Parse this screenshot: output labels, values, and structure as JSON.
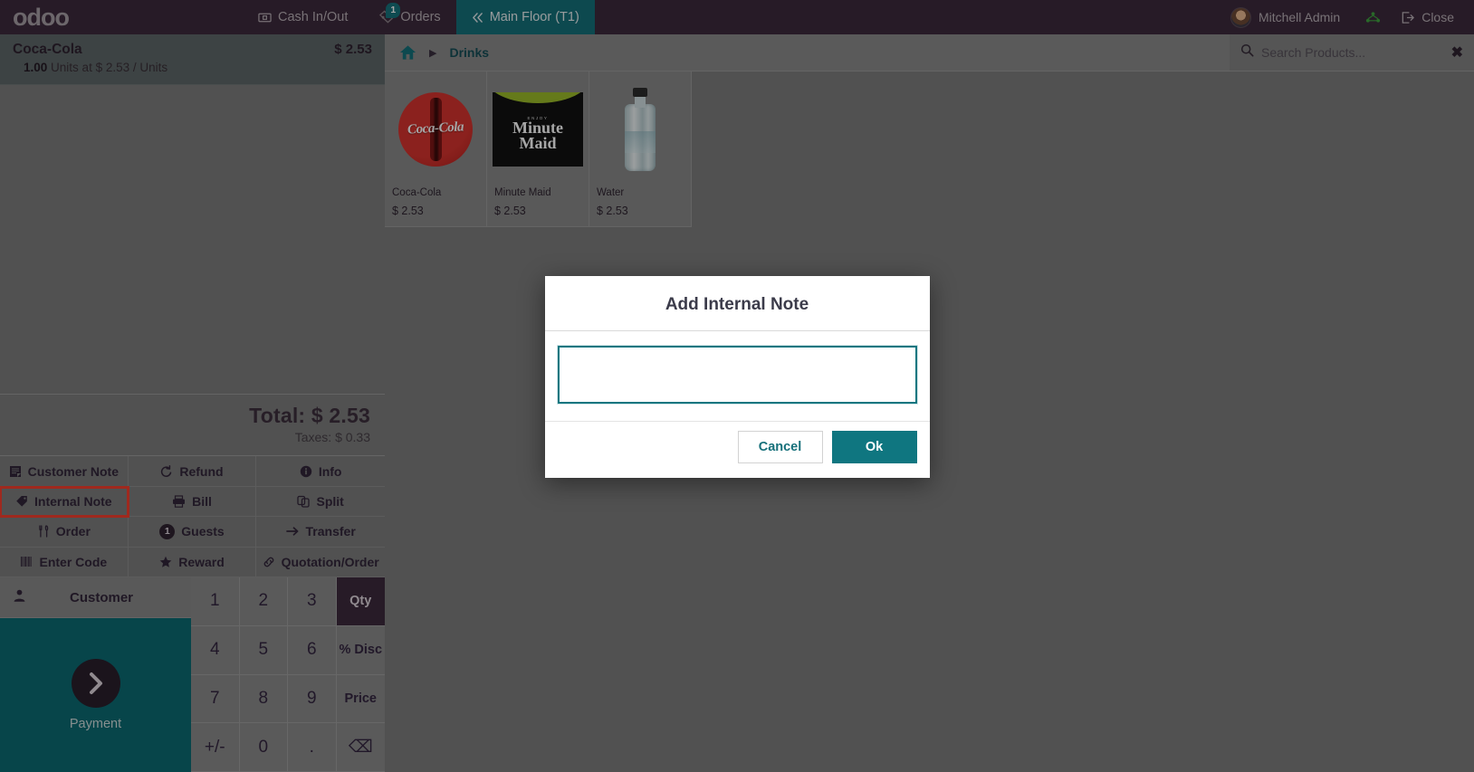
{
  "topbar": {
    "logo": "odoo",
    "cash_in_out": "Cash In/Out",
    "orders": "Orders",
    "orders_badge": "1",
    "floor": "Main Floor (T1)",
    "user": "Mitchell Admin",
    "close": "Close"
  },
  "order": {
    "lines": [
      {
        "name": "Coca-Cola",
        "price": "$ 2.53",
        "qty": "1.00",
        "detail": "Units at $ 2.53 / Units"
      }
    ],
    "total_label": "Total: $ 2.53",
    "taxes_label": "Taxes: $ 0.33"
  },
  "actions": [
    {
      "label": "Customer Note",
      "icon": "note-icon"
    },
    {
      "label": "Refund",
      "icon": "refund-icon"
    },
    {
      "label": "Info",
      "icon": "info-icon"
    },
    {
      "label": "Internal Note",
      "icon": "tag-icon",
      "highlight": true
    },
    {
      "label": "Bill",
      "icon": "printer-icon"
    },
    {
      "label": "Split",
      "icon": "split-icon"
    },
    {
      "label": "Order",
      "icon": "cutlery-icon"
    },
    {
      "label": "Guests",
      "icon": "guests-icon",
      "badge": "1"
    },
    {
      "label": "Transfer",
      "icon": "arrow-right-icon"
    },
    {
      "label": "Enter Code",
      "icon": "barcode-icon"
    },
    {
      "label": "Reward",
      "icon": "star-icon"
    },
    {
      "label": "Quotation/Order",
      "icon": "link-icon"
    }
  ],
  "customer_button": "Customer",
  "payment_button": "Payment",
  "numpad": [
    {
      "label": "1",
      "kind": "digit"
    },
    {
      "label": "2",
      "kind": "digit"
    },
    {
      "label": "3",
      "kind": "digit"
    },
    {
      "label": "Qty",
      "kind": "mode",
      "active": true
    },
    {
      "label": "4",
      "kind": "digit"
    },
    {
      "label": "5",
      "kind": "digit"
    },
    {
      "label": "6",
      "kind": "digit"
    },
    {
      "label": "% Disc",
      "kind": "mode"
    },
    {
      "label": "7",
      "kind": "digit"
    },
    {
      "label": "8",
      "kind": "digit"
    },
    {
      "label": "9",
      "kind": "digit"
    },
    {
      "label": "Price",
      "kind": "mode"
    },
    {
      "label": "+/-",
      "kind": "digit"
    },
    {
      "label": "0",
      "kind": "digit"
    },
    {
      "label": ".",
      "kind": "digit"
    },
    {
      "label": "⌫",
      "kind": "backspace"
    }
  ],
  "products_panel": {
    "breadcrumb_home": "home-icon",
    "breadcrumb_category": "Drinks",
    "search_placeholder": "Search Products...",
    "products": [
      {
        "name": "Coca-Cola",
        "price": "$ 2.53",
        "art": "coke"
      },
      {
        "name": "Minute Maid",
        "price": "$ 2.53",
        "art": "minutemaid"
      },
      {
        "name": "Water",
        "price": "$ 2.53",
        "art": "water"
      }
    ]
  },
  "modal": {
    "title": "Add Internal Note",
    "input_value": "",
    "input_placeholder": "",
    "cancel": "Cancel",
    "ok": "Ok"
  },
  "colors": {
    "brand_purple": "#3c2a3c",
    "teal": "#0f7680",
    "highlight_red": "#f43f2e",
    "panel_gray": "#7d7d7d"
  }
}
